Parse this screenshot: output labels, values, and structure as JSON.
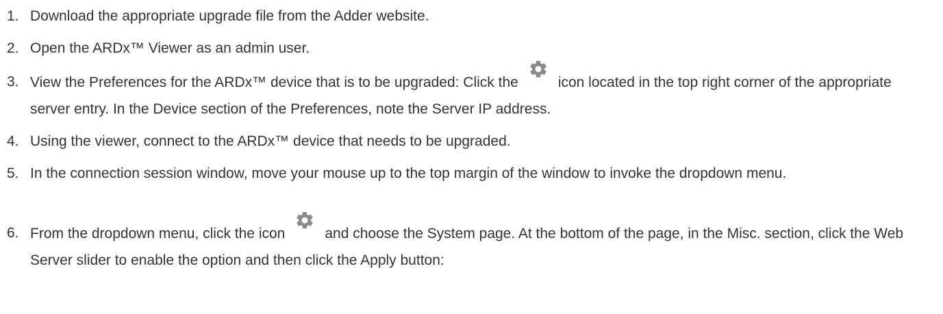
{
  "steps": [
    {
      "num": "1.",
      "text": "Download the appropriate upgrade file from the Adder website."
    },
    {
      "num": "2.",
      "text": "Open the ARDx™ Viewer as an admin user."
    },
    {
      "num": "3.",
      "text_before": "View the Preferences for the ARDx™ device that is to be upgraded: Click the",
      "icon": "gear-icon",
      "text_after": "icon located in the top right corner of the appropriate server entry. In the Device section of the Preferences, note the Server IP address."
    },
    {
      "num": "4.",
      "text": "Using the viewer, connect to the ARDx™ device that needs to be upgraded."
    },
    {
      "num": "5.",
      "text": "In the connection session window, move your mouse up to the top margin of the window to invoke the dropdown menu."
    },
    {
      "num": "6.",
      "text_before": "From the dropdown menu, click the icon",
      "icon": "gear-icon",
      "text_after": "and choose the System page. At the bottom of the page, in the Misc. section, click the Web Server slider to enable the option and then click the Apply button:"
    }
  ],
  "colors": {
    "text": "#333333",
    "gear": "#8a8a8a"
  }
}
